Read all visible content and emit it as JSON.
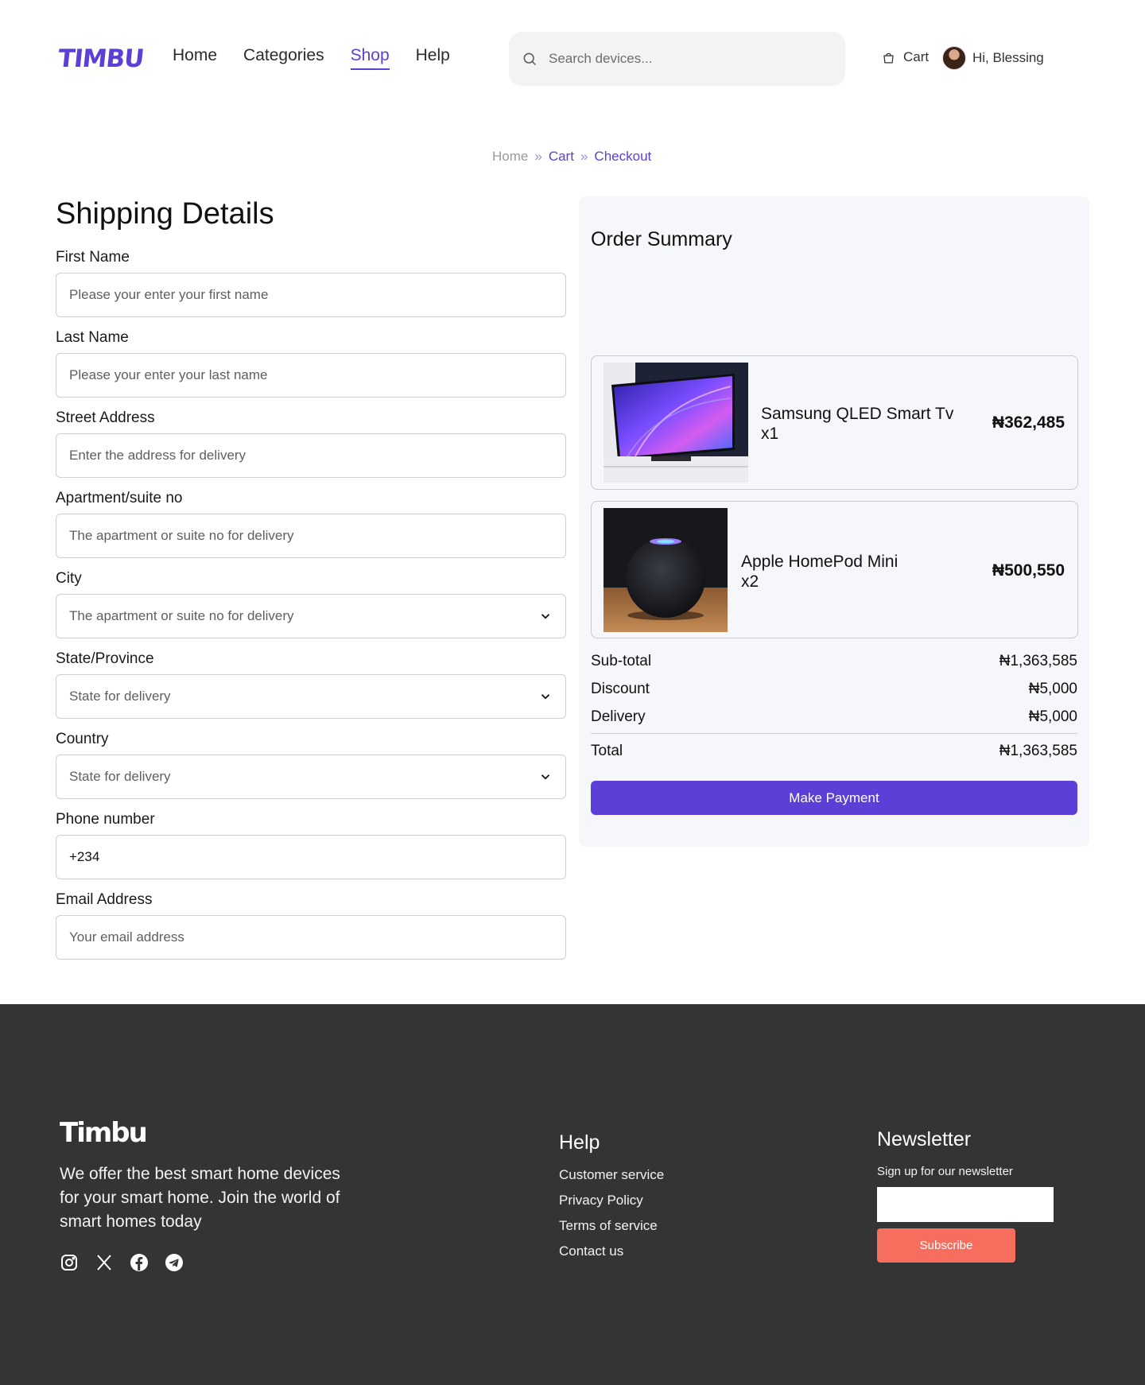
{
  "header": {
    "logo": "TIMBU",
    "nav": [
      {
        "label": "Home",
        "active": false
      },
      {
        "label": "Categories",
        "active": false
      },
      {
        "label": "Shop",
        "active": true
      },
      {
        "label": "Help",
        "active": false
      }
    ],
    "search_placeholder": "Search devices...",
    "cart_label": "Cart",
    "greeting": "Hi, Blessing"
  },
  "breadcrumb": {
    "home": "Home",
    "cart": "Cart",
    "current": "Checkout"
  },
  "shipping": {
    "title": "Shipping Details",
    "fields": {
      "first_name": {
        "label": "First Name",
        "placeholder": "Please your enter your first name"
      },
      "last_name": {
        "label": "Last Name",
        "placeholder": "Please your enter your last name"
      },
      "street": {
        "label": "Street Address",
        "placeholder": "Enter the address for delivery"
      },
      "apartment": {
        "label": "Apartment/suite no",
        "placeholder": "The apartment or suite no for delivery"
      },
      "city": {
        "label": "City",
        "value": "The apartment or suite no for delivery"
      },
      "state": {
        "label": "State/Province",
        "value": "State for delivery"
      },
      "country": {
        "label": "Country",
        "value": "State for delivery"
      },
      "phone": {
        "label": "Phone number",
        "value": "+234"
      },
      "email": {
        "label": "Email Address",
        "placeholder": "Your email address"
      }
    }
  },
  "summary": {
    "title": "Order Summary",
    "items": [
      {
        "name": "Samsung QLED Smart Tv",
        "qty": "x1",
        "price": "₦362,485",
        "image": "tv-image"
      },
      {
        "name": "Apple HomePod Mini",
        "qty": "x2",
        "price": "₦500,550",
        "image": "homepod-image"
      }
    ],
    "subtotal_label": "Sub-total",
    "subtotal": "₦1,363,585",
    "discount_label": "Discount",
    "discount": "₦5,000",
    "delivery_label": "Delivery",
    "delivery": "₦5,000",
    "total_label": "Total",
    "total": "₦1,363,585",
    "pay_label": "Make Payment"
  },
  "footer": {
    "logo": "Timbu",
    "about": "We offer the best smart home devices for your smart home. Join the world of smart homes today",
    "socials": [
      "instagram-icon",
      "x-icon",
      "facebook-icon",
      "telegram-icon"
    ],
    "help_title": "Help",
    "help_links": [
      "Customer service",
      "Privacy Policy",
      "Terms of service",
      "Contact us"
    ],
    "newsletter_title": "Newsletter",
    "newsletter_text": "Sign up for our newsletter",
    "subscribe_label": "Subscribe"
  },
  "colors": {
    "accent": "#5b3fd6",
    "footer_bg": "#343434",
    "subscribe": "#f76e5f",
    "summary_bg": "#f6f7fb"
  }
}
